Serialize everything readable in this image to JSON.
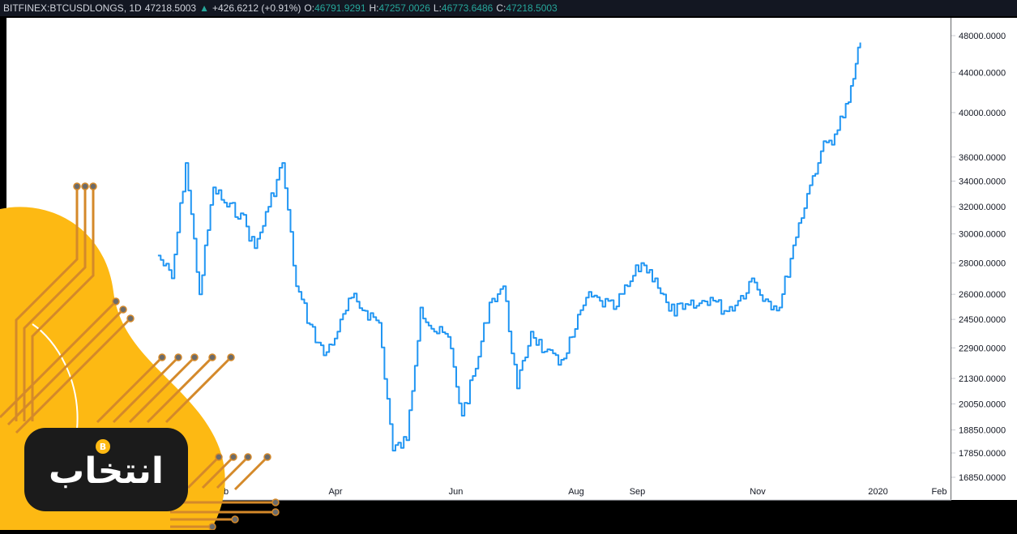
{
  "header": {
    "symbol": "BITFINEX:BTCUSDLONGS, 1D",
    "last": "47218.5003",
    "change": "+426.6212 (+0.91%)",
    "o_label": "O:",
    "o_value": "46791.9291",
    "h_label": "H:",
    "h_value": "47257.0026",
    "l_label": "L:",
    "l_value": "46773.6486",
    "c_label": "C:",
    "c_value": "47218.5003"
  },
  "logo": {
    "text": "انتخاب",
    "badge": "B"
  },
  "chart_data": {
    "type": "line",
    "y_scale": "log",
    "ylim": [
      16850,
      48000
    ],
    "y_ticks": [
      "48000.0000",
      "44000.0000",
      "40000.0000",
      "36000.0000",
      "34000.0000",
      "32000.0000",
      "30000.0000",
      "28000.0000",
      "26000.0000",
      "24500.0000",
      "22900.0000",
      "21300.0000",
      "20050.0000",
      "18850.0000",
      "17850.0000",
      "16850.0000"
    ],
    "x_ticks": [
      "eb",
      "Apr",
      "Jun",
      "Aug",
      "Sep",
      "Nov",
      "2020",
      "Feb"
    ],
    "x": [
      "2019-01-01",
      "2019-01-08",
      "2019-01-15",
      "2019-01-22",
      "2019-01-29",
      "2019-02-05",
      "2019-02-12",
      "2019-02-19",
      "2019-02-26",
      "2019-03-05",
      "2019-03-12",
      "2019-03-19",
      "2019-03-26",
      "2019-04-02",
      "2019-04-09",
      "2019-04-16",
      "2019-04-23",
      "2019-04-30",
      "2019-05-07",
      "2019-05-14",
      "2019-05-21",
      "2019-05-28",
      "2019-06-04",
      "2019-06-11",
      "2019-06-18",
      "2019-06-25",
      "2019-07-02",
      "2019-07-09",
      "2019-07-16",
      "2019-07-23",
      "2019-07-30",
      "2019-08-06",
      "2019-08-13",
      "2019-08-20",
      "2019-08-27",
      "2019-09-03",
      "2019-09-10",
      "2019-09-17",
      "2019-09-24",
      "2019-10-01",
      "2019-10-08",
      "2019-10-15",
      "2019-10-22",
      "2019-10-29",
      "2019-11-05",
      "2019-11-12",
      "2019-11-19",
      "2019-11-26",
      "2019-12-03",
      "2019-12-10",
      "2019-12-17",
      "2019-12-23"
    ],
    "values": [
      28500,
      27000,
      35500,
      26000,
      33500,
      32000,
      31500,
      29000,
      32000,
      35500,
      26500,
      24200,
      22500,
      23800,
      25800,
      25000,
      24300,
      17950,
      18400,
      25200,
      23800,
      23500,
      19500,
      21800,
      25500,
      26500,
      20800,
      23800,
      22700,
      22000,
      23500,
      25800,
      25600,
      25100,
      26500,
      28000,
      27000,
      25000,
      25100,
      25300,
      25800,
      25000,
      25600,
      27000,
      25700,
      25200,
      29200,
      33000,
      36500,
      38000,
      41000,
      47218.5003
    ]
  }
}
